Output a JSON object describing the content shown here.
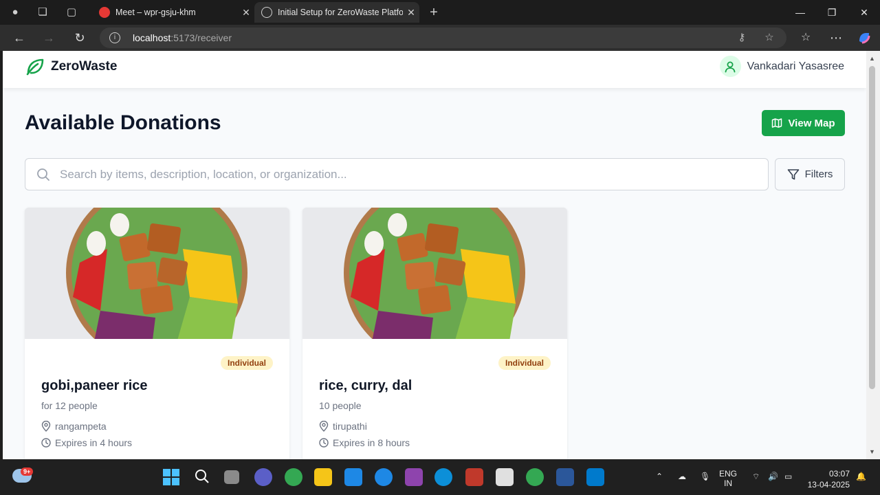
{
  "browser": {
    "tabs": [
      {
        "title": "Meet – wpr-gsju-khm",
        "active": false
      },
      {
        "title": "Initial Setup for ZeroWaste Platfor",
        "active": true
      }
    ],
    "url_host": "localhost",
    "url_path": ":5173/receiver"
  },
  "app": {
    "brand": "ZeroWaste",
    "user_name": "Vankadari Yasasree",
    "page_title": "Available Donations",
    "view_map_label": "View Map",
    "search_placeholder": "Search by items, description, location, or organization...",
    "filters_label": "Filters",
    "accent_color": "#16a34a"
  },
  "donations": [
    {
      "badge": "Individual",
      "title": "gobi,paneer rice",
      "subtitle": "for 12 people",
      "location": "rangampeta",
      "expires": "Expires in 4 hours"
    },
    {
      "badge": "Individual",
      "title": "rice, curry, dal",
      "subtitle": "10 people",
      "location": "tirupathi",
      "expires": "Expires in 8 hours"
    }
  ],
  "taskbar": {
    "notification_count": "9+",
    "lang_line1": "ENG",
    "lang_line2": "IN",
    "time": "03:07",
    "date": "13-04-2025"
  }
}
